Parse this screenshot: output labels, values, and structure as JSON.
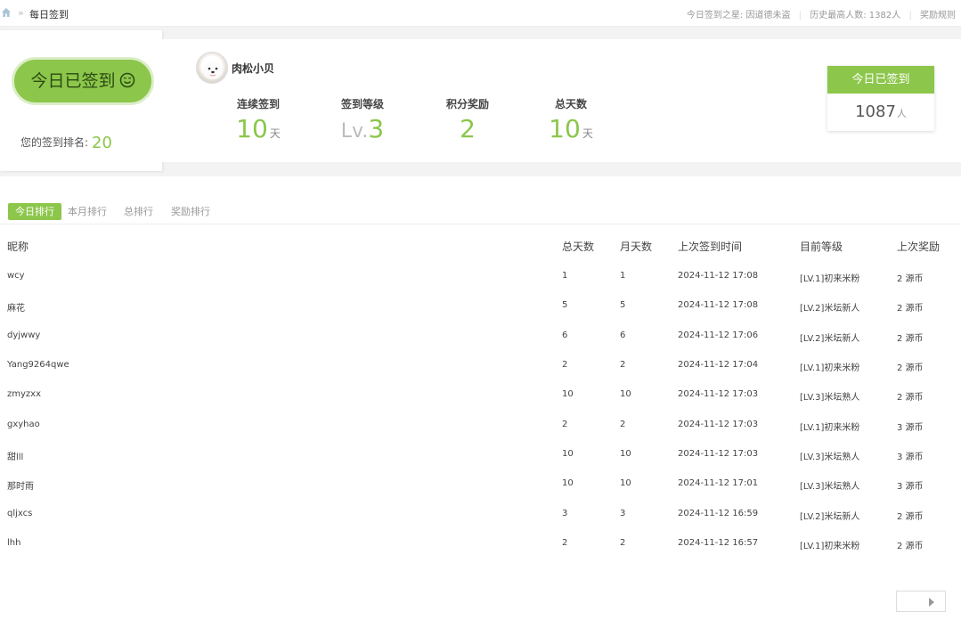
{
  "breadcrumb": {
    "separator": "»",
    "current": "每日签到"
  },
  "top_info": {
    "star_label": "今日签到之星:",
    "star_value": "因道德未盗",
    "history_label": "历史最高人数:",
    "history_value": "1382人",
    "rules_label": "奖励规则"
  },
  "sign": {
    "button_label": "今日已签到",
    "rank_label": "您的签到排名:",
    "rank_value": "20"
  },
  "user": {
    "name": "肉松小贝",
    "stats": [
      {
        "label": "连续签到",
        "value": "10",
        "unit": "天"
      },
      {
        "label": "签到等级",
        "prefix": "Lv.",
        "value": "3",
        "unit": ""
      },
      {
        "label": "积分奖励",
        "value": "2",
        "unit": ""
      },
      {
        "label": "总天数",
        "value": "10",
        "unit": "天"
      }
    ]
  },
  "today_box": {
    "title": "今日已签到",
    "count": "1087",
    "unit": "人"
  },
  "tabs": [
    "今日排行",
    "本月排行",
    "总排行",
    "奖励排行"
  ],
  "table": {
    "headers": [
      "昵称",
      "总天数",
      "月天数",
      "上次签到时间",
      "目前等级",
      "上次奖励"
    ],
    "rows": [
      [
        "wcy",
        "1",
        "1",
        "2024-11-12 17:08",
        "[LV.1]初来米粉",
        "2 源币"
      ],
      [
        "麻花",
        "5",
        "5",
        "2024-11-12 17:08",
        "[LV.2]米坛新人",
        "2 源币"
      ],
      [
        "dyjwwy",
        "6",
        "6",
        "2024-11-12 17:06",
        "[LV.2]米坛新人",
        "2 源币"
      ],
      [
        "Yang9264qwe",
        "2",
        "2",
        "2024-11-12 17:04",
        "[LV.1]初来米粉",
        "2 源币"
      ],
      [
        "zmyzxx",
        "10",
        "10",
        "2024-11-12 17:03",
        "[LV.3]米坛熟人",
        "2 源币"
      ],
      [
        "gxyhao",
        "2",
        "2",
        "2024-11-12 17:03",
        "[LV.1]初来米粉",
        "3 源币"
      ],
      [
        "甜lll",
        "10",
        "10",
        "2024-11-12 17:03",
        "[LV.3]米坛熟人",
        "3 源币"
      ],
      [
        "那时雨",
        "10",
        "10",
        "2024-11-12 17:01",
        "[LV.3]米坛熟人",
        "3 源币"
      ],
      [
        "qljxcs",
        "3",
        "3",
        "2024-11-12 16:59",
        "[LV.2]米坛新人",
        "2 源币"
      ],
      [
        "lhh",
        "2",
        "2",
        "2024-11-12 16:57",
        "[LV.1]初来米粉",
        "2 源币"
      ]
    ]
  },
  "colors": {
    "accent": "#8cc64b"
  },
  "icons": {
    "home": "home-icon",
    "smile": "smile-icon",
    "next": "chevron-right-icon"
  }
}
